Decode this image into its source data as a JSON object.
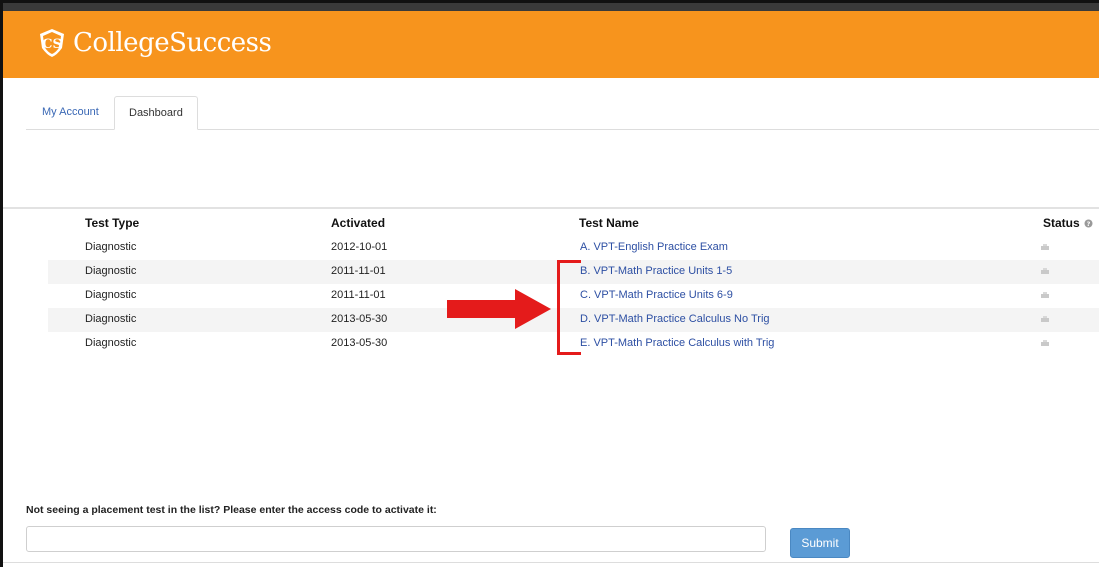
{
  "brand": {
    "name": "CollegeSuccess",
    "header_color": "#f7941d"
  },
  "tabs": [
    {
      "label": "My Account",
      "active": false
    },
    {
      "label": "Dashboard",
      "active": true
    }
  ],
  "table": {
    "headers": {
      "type": "Test Type",
      "activated": "Activated",
      "name": "Test Name",
      "status": "Status"
    },
    "rows": [
      {
        "type": "Diagnostic",
        "activated": "2012-10-01",
        "name": "A. VPT-English Practice Exam"
      },
      {
        "type": "Diagnostic",
        "activated": "2011-11-01",
        "name": "B. VPT-Math Practice Units 1-5"
      },
      {
        "type": "Diagnostic",
        "activated": "2011-11-01",
        "name": "C. VPT-Math Practice Units 6-9"
      },
      {
        "type": "Diagnostic",
        "activated": "2013-05-30",
        "name": "D. VPT-Math Practice Calculus No Trig"
      },
      {
        "type": "Diagnostic",
        "activated": "2013-05-30",
        "name": "E. VPT-Math Practice Calculus with Trig"
      }
    ]
  },
  "activation": {
    "prompt": "Not seeing a placement test in the list? Please enter the access code to activate it:",
    "input_value": "",
    "submit_label": "Submit"
  },
  "annotation_color": "#e41b1b",
  "icons": {
    "status_help": "help-icon",
    "status_row": "printer-icon"
  }
}
